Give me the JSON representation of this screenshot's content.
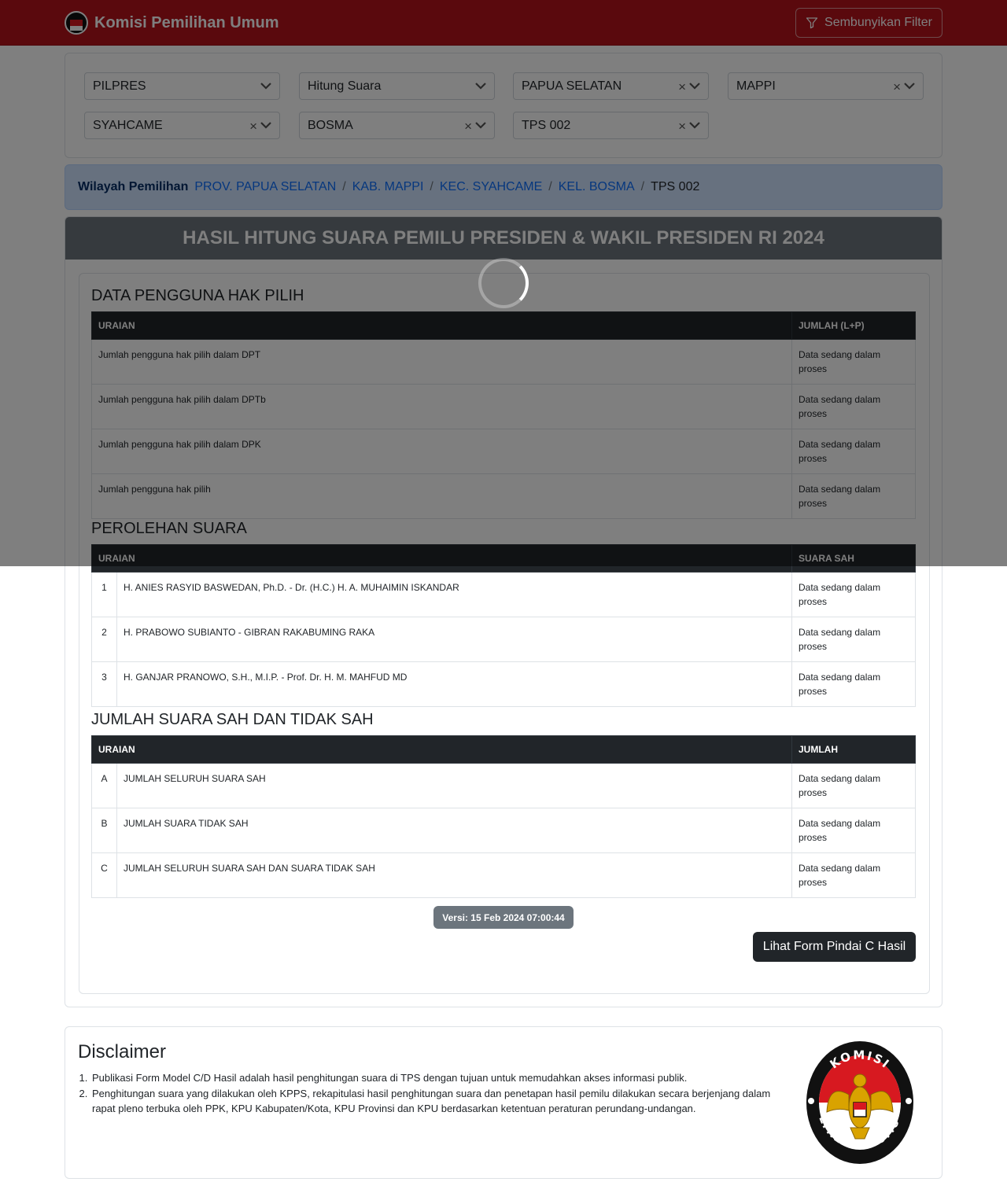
{
  "navbar": {
    "brand": "Komisi Pemilihan Umum",
    "filter_button": "Sembunyikan Filter"
  },
  "filters": [
    {
      "value": "PILPRES",
      "clearable": false
    },
    {
      "value": "Hitung Suara",
      "clearable": false
    },
    {
      "value": "PAPUA SELATAN",
      "clearable": true
    },
    {
      "value": "MAPPI",
      "clearable": true
    },
    {
      "value": "SYAHCAME",
      "clearable": true
    },
    {
      "value": "BOSMA",
      "clearable": true
    },
    {
      "value": "TPS 002",
      "clearable": true
    }
  ],
  "breadcrumb": {
    "title": "Wilayah Pemilihan",
    "items": [
      "PROV. PAPUA SELATAN",
      "KAB. MAPPI",
      "KEC. SYAHCAME",
      "KEL. BOSMA"
    ],
    "current": "TPS 002"
  },
  "main": {
    "header": "HASIL HITUNG SUARA PEMILU PRESIDEN & WAKIL PRESIDEN RI 2024"
  },
  "pengguna": {
    "title": "DATA PENGGUNA HAK PILIH",
    "col_uraian": "URAIAN",
    "col_jumlah": "JUMLAH (L+P)",
    "rows": [
      {
        "label": "Jumlah pengguna hak pilih dalam DPT",
        "value": "Data sedang dalam proses"
      },
      {
        "label": "Jumlah pengguna hak pilih dalam DPTb",
        "value": "Data sedang dalam proses"
      },
      {
        "label": "Jumlah pengguna hak pilih dalam DPK",
        "value": "Data sedang dalam proses"
      },
      {
        "label": "Jumlah pengguna hak pilih",
        "value": "Data sedang dalam proses"
      }
    ]
  },
  "perolehan": {
    "title": "PEROLEHAN SUARA",
    "col_uraian": "URAIAN",
    "col_suara": "SUARA SAH",
    "rows": [
      {
        "no": "1",
        "label": "H. ANIES RASYID BASWEDAN, Ph.D. - Dr. (H.C.) H. A. MUHAIMIN ISKANDAR",
        "value": "Data sedang dalam proses"
      },
      {
        "no": "2",
        "label": "H. PRABOWO SUBIANTO - GIBRAN RAKABUMING RAKA",
        "value": "Data sedang dalam proses"
      },
      {
        "no": "3",
        "label": "H. GANJAR PRANOWO, S.H., M.I.P. - Prof. Dr. H. M. MAHFUD MD",
        "value": "Data sedang dalam proses"
      }
    ]
  },
  "jumlah": {
    "title": "JUMLAH SUARA SAH DAN TIDAK SAH",
    "col_uraian": "URAIAN",
    "col_jumlah": "JUMLAH",
    "rows": [
      {
        "no": "A",
        "label": "JUMLAH SELURUH SUARA SAH",
        "value": "Data sedang dalam proses"
      },
      {
        "no": "B",
        "label": "JUMLAH SUARA TIDAK SAH",
        "value": "Data sedang dalam proses"
      },
      {
        "no": "C",
        "label": "JUMLAH SELURUH SUARA SAH DAN SUARA TIDAK SAH",
        "value": "Data sedang dalam proses"
      }
    ]
  },
  "version": "Versi: 15 Feb 2024 07:00:44",
  "scan_button": "Lihat Form Pindai C Hasil",
  "disclaimer": {
    "title": "Disclaimer",
    "items": [
      "Publikasi Form Model C/D Hasil adalah hasil penghitungan suara di TPS dengan tujuan untuk memudahkan akses informasi publik.",
      "Penghitungan suara yang dilakukan oleh KPPS, rekapitulasi hasil penghitungan suara dan penetapan hasil pemilu dilakukan secara berjenjang dalam rapat pleno terbuka oleh PPK, KPU Kabupaten/Kota, KPU Provinsi dan KPU berdasarkan ketentuan peraturan perundang-undangan."
    ],
    "logo_text_top": "KOMISI",
    "logo_text_bottom": "PEMILIHAN UMUM"
  },
  "colors": {
    "navbar": "#b4131b",
    "header_gray": "#6c757d",
    "table_header": "#212529",
    "breadcrumb_bg": "#cfe2ff",
    "link": "#0d6efd"
  },
  "icons": {
    "filter": "funnel-icon",
    "select_arrow": "chevron-down-icon",
    "clear": "close-icon",
    "loading": "spinner-icon"
  }
}
